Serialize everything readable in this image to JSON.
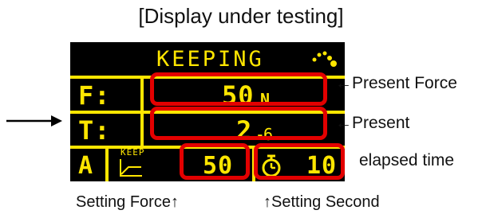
{
  "header": {
    "title": "[Display under testing]"
  },
  "display": {
    "mode_label": "KEEPING",
    "force": {
      "label": "F:",
      "value": "50",
      "unit": "N"
    },
    "time": {
      "label": "T:",
      "value": "2.",
      "fraction": "6"
    },
    "bottom_bar": {
      "mode_letter": "A",
      "keep_label": "KEEP",
      "setting_force": "50",
      "setting_seconds": "10"
    }
  },
  "annotations": {
    "present_force": "←Present Force",
    "present": "←Present",
    "elapsed_time": "elapsed time",
    "setting_force": "Setting Force↑",
    "setting_second": "↑Setting Second"
  },
  "colors": {
    "lcd_bg": "#000000",
    "lcd_text": "#ffe600",
    "highlight": "#e30000"
  }
}
